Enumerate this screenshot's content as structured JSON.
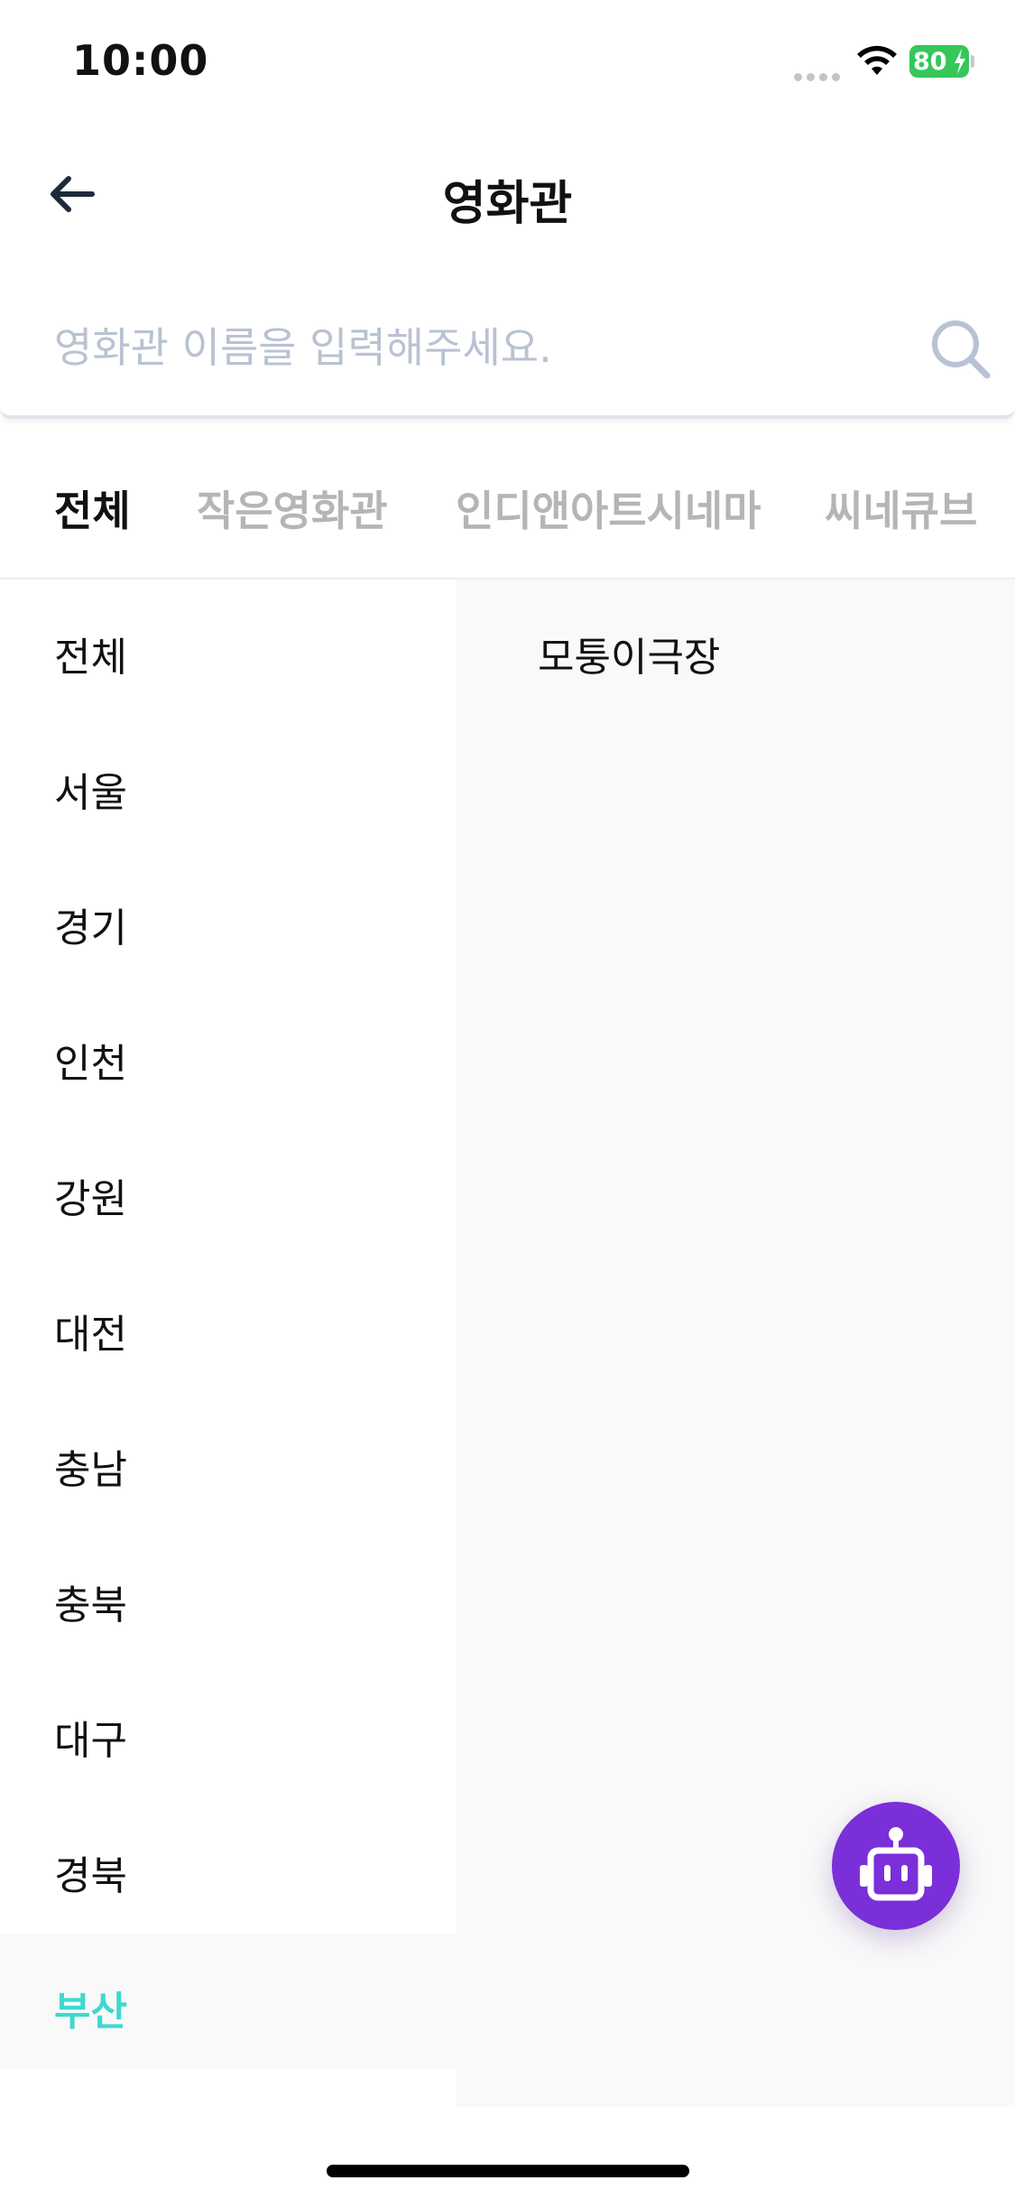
{
  "status_bar": {
    "time": "10:00",
    "battery_level": "80",
    "icons": [
      "signal-dots-icon",
      "wifi-icon",
      "battery-charging-icon"
    ]
  },
  "header": {
    "title": "영화관",
    "back_icon": "arrow-left-icon"
  },
  "search": {
    "placeholder": "영화관 이름을 입력해주세요.",
    "value": "",
    "icon": "search-icon"
  },
  "tabs": [
    {
      "label": "전체",
      "active": true
    },
    {
      "label": "작은영화관",
      "active": false
    },
    {
      "label": "인디앤아트시네마",
      "active": false
    },
    {
      "label": "씨네큐브",
      "active": false
    }
  ],
  "regions": [
    {
      "label": "전체"
    },
    {
      "label": "서울"
    },
    {
      "label": "경기"
    },
    {
      "label": "인천"
    },
    {
      "label": "강원"
    },
    {
      "label": "대전"
    },
    {
      "label": "충남"
    },
    {
      "label": "충북"
    },
    {
      "label": "대구"
    },
    {
      "label": "경북"
    },
    {
      "label": "부산",
      "selected": true
    }
  ],
  "theaters": [
    {
      "label": "모퉁이극장"
    }
  ],
  "floating_button": {
    "icon": "robot-icon",
    "color": "#7b2fd9"
  },
  "colors": {
    "accent": "#3fd8d0",
    "panel_bg": "#f9f9f9",
    "inactive_tab": "#b5b5b5",
    "placeholder": "#b9c2d3"
  }
}
